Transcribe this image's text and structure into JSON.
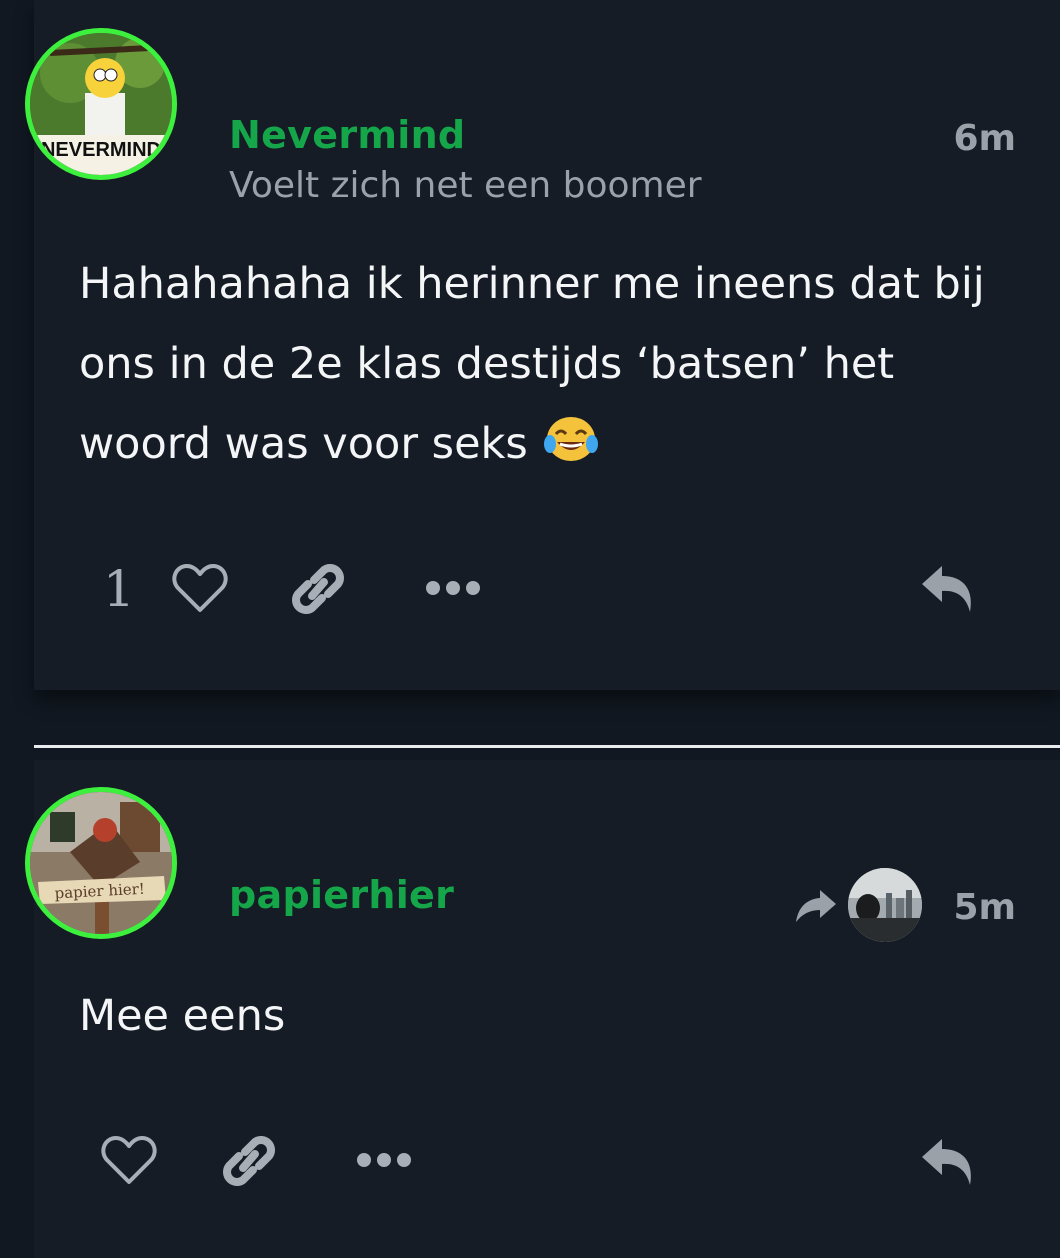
{
  "posts": [
    {
      "username": "Nevermind",
      "user_title": "Voelt zich net een boomer",
      "time": "6m",
      "body": "Hahahahaha ik herinner me ineens dat bij ons in de 2e klas destijds ‘batsen’ het woord was voor seks",
      "body_emoji": "😂",
      "avatar_text": "NEVERMIND",
      "like_count": "1",
      "icons": {
        "like": "heart-icon",
        "link": "link-icon",
        "more": "ellipsis-icon",
        "reply": "reply-icon"
      }
    },
    {
      "username": "papierhier",
      "time": "5m",
      "body": "Mee eens",
      "avatar_text": "papier hier!",
      "icons": {
        "reply_indicator": "share-arrow-icon",
        "like": "heart-icon",
        "link": "link-icon",
        "more": "ellipsis-icon",
        "reply": "reply-icon"
      }
    }
  ],
  "colors": {
    "background": "#111821",
    "card": "#151c26",
    "username": "#15a64a",
    "avatar_ring": "#3ef03e",
    "muted": "#9aa1a9",
    "text": "#f4f5f6"
  }
}
